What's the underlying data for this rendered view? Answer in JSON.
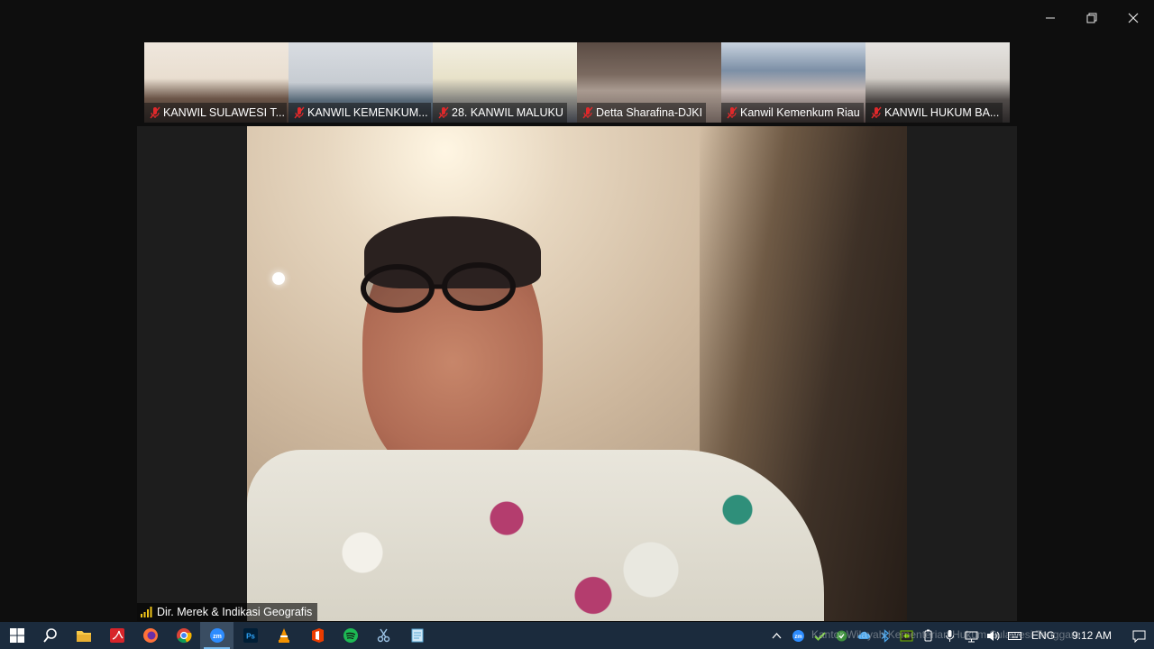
{
  "thumbnails": [
    {
      "name": "KANWIL SULAWESI T..."
    },
    {
      "name": "KANWIL KEMENKUM..."
    },
    {
      "name": "28. KANWIL MALUKU"
    },
    {
      "name": "Detta Sharafina-DJKI"
    },
    {
      "name": "Kanwil Kemenkum Riau"
    },
    {
      "name": "KANWIL HUKUM BA..."
    }
  ],
  "main_speaker": {
    "name": "Dir. Merek & Indikasi Geografis"
  },
  "taskbar": {
    "apps": [
      "start-icon",
      "search-icon",
      "file-explorer-icon",
      "pdf-reader-icon",
      "firefox-icon",
      "chrome-icon",
      "zoom-icon",
      "photoshop-icon",
      "vlc-icon",
      "office-icon",
      "spotify-icon",
      "snipping-tool-icon",
      "notepad-icon"
    ],
    "language": "ENG",
    "time": "9:12 AM",
    "overlay": "Kantor Wilayah Kementerian Hukum Sulawesi Tenggara"
  },
  "colors": {
    "taskbar": "#1b2b3d",
    "mic_muted": "#e0292b",
    "active_indicator": "#76b9ed"
  }
}
